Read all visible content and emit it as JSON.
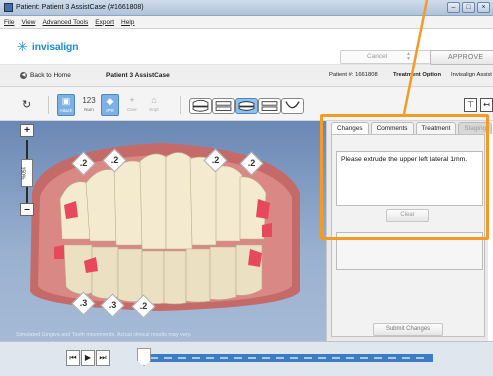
{
  "window": {
    "title": "Patient: Patient 3 AssistCase (#1661808)"
  },
  "menu": [
    "File",
    "View",
    "Advanced Tools",
    "Export",
    "Help"
  ],
  "brand": {
    "logo_text": "invisalign",
    "cancel_label": "Cancel",
    "approve_label": "APPROVE"
  },
  "nav": {
    "back_label": "Back to Home",
    "patient_name": "Patient 3 AssistCase",
    "patient_number": "Patient #: 1661808",
    "treatment_option": "Treatment Option",
    "assist_label": "Invisalign Assist"
  },
  "tools": [
    {
      "icon": "▣",
      "label": "Attach"
    },
    {
      "icon": "123",
      "label": "Num"
    },
    {
      "icon": "◆",
      "label": "IPR"
    },
    {
      "icon": "+",
      "label": "Over"
    },
    {
      "icon": "⌂",
      "label": "Enpt"
    }
  ],
  "viewport": {
    "zoom_label": "150%",
    "caption": "Simulated Gingiva and Tooth movements. Actual clinical results may vary.",
    "ipr_upper": [
      ".2",
      ".2",
      ".2",
      ".2"
    ],
    "ipr_lower": [
      ".3",
      ".3",
      ".2"
    ]
  },
  "panel": {
    "tabs": [
      "Changes",
      "Comments",
      "Treatment",
      "Staging"
    ],
    "comment_text": "Please extrude the upper left lateral 1mm.",
    "clear_label": "Clear",
    "submit_label": "Submit Changes"
  },
  "colors": {
    "highlight": "#f39b25",
    "accent": "#1f8fd4",
    "timeline": "#3c7cc0"
  }
}
